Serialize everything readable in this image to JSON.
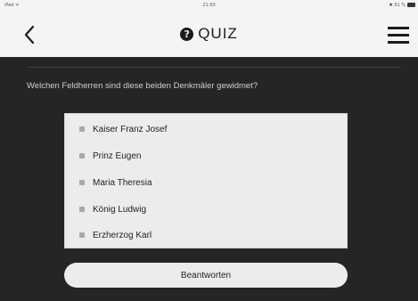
{
  "status_bar": {
    "carrier": "iPad ᯤ",
    "time": "21:50",
    "battery": "✱ 91 %"
  },
  "nav": {
    "title": "QUIZ",
    "help_icon_glyph": "?"
  },
  "quiz": {
    "question": "Welchen Feldherren sind diese beiden Denkmäler gewidmet?",
    "options": [
      {
        "label": "Kaiser Franz Josef"
      },
      {
        "label": "Prinz Eugen"
      },
      {
        "label": "Maria Theresia"
      },
      {
        "label": "König Ludwig"
      },
      {
        "label": "Erzherzog Karl"
      }
    ],
    "submit_label": "Beantworten"
  },
  "colors": {
    "header_bg": "#f4f4f4",
    "content_bg": "#252525",
    "panel_bg": "#ececec",
    "text_dark": "#1c1c1c",
    "question_text": "#cfcfcf"
  },
  "icons": {
    "back": "chevron-left-icon",
    "help": "help-circle-icon",
    "menu": "hamburger-menu-icon",
    "battery": "battery-icon",
    "option_marker": "radio-square-icon"
  }
}
